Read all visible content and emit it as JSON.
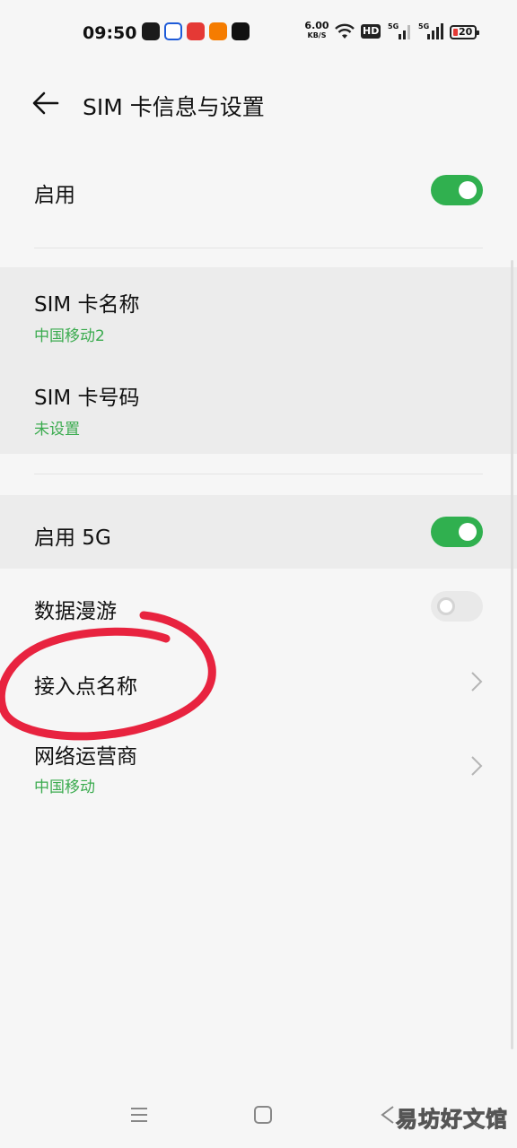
{
  "status_bar": {
    "time": "09:50",
    "net_speed": "6.00",
    "net_unit": "KB/S",
    "hd_label": "HD",
    "sig1_tag": "5G",
    "sig2_tag": "5G",
    "battery_level": "20",
    "app_icon_colors": [
      "#1a1a1a",
      "#1e5bd8",
      "#e53935",
      "#f57c00",
      "#111111"
    ]
  },
  "header": {
    "title": "SIM 卡信息与设置"
  },
  "settings": {
    "enable_label": "启用",
    "enable_on": true,
    "sim_name_label": "SIM 卡名称",
    "sim_name_value": "中国移动2",
    "sim_number_label": "SIM 卡号码",
    "sim_number_value": "未设置",
    "enable_5g_label": "启用 5G",
    "enable_5g_on": true,
    "roaming_label": "数据漫游",
    "roaming_on": false,
    "apn_label": "接入点名称",
    "carrier_label": "网络运营商",
    "carrier_value": "中国移动"
  },
  "colors": {
    "accent_green": "#30b04f",
    "value_green": "#3bab4f",
    "annotation_red": "#e8233f"
  },
  "watermark": "易坊好文馆"
}
